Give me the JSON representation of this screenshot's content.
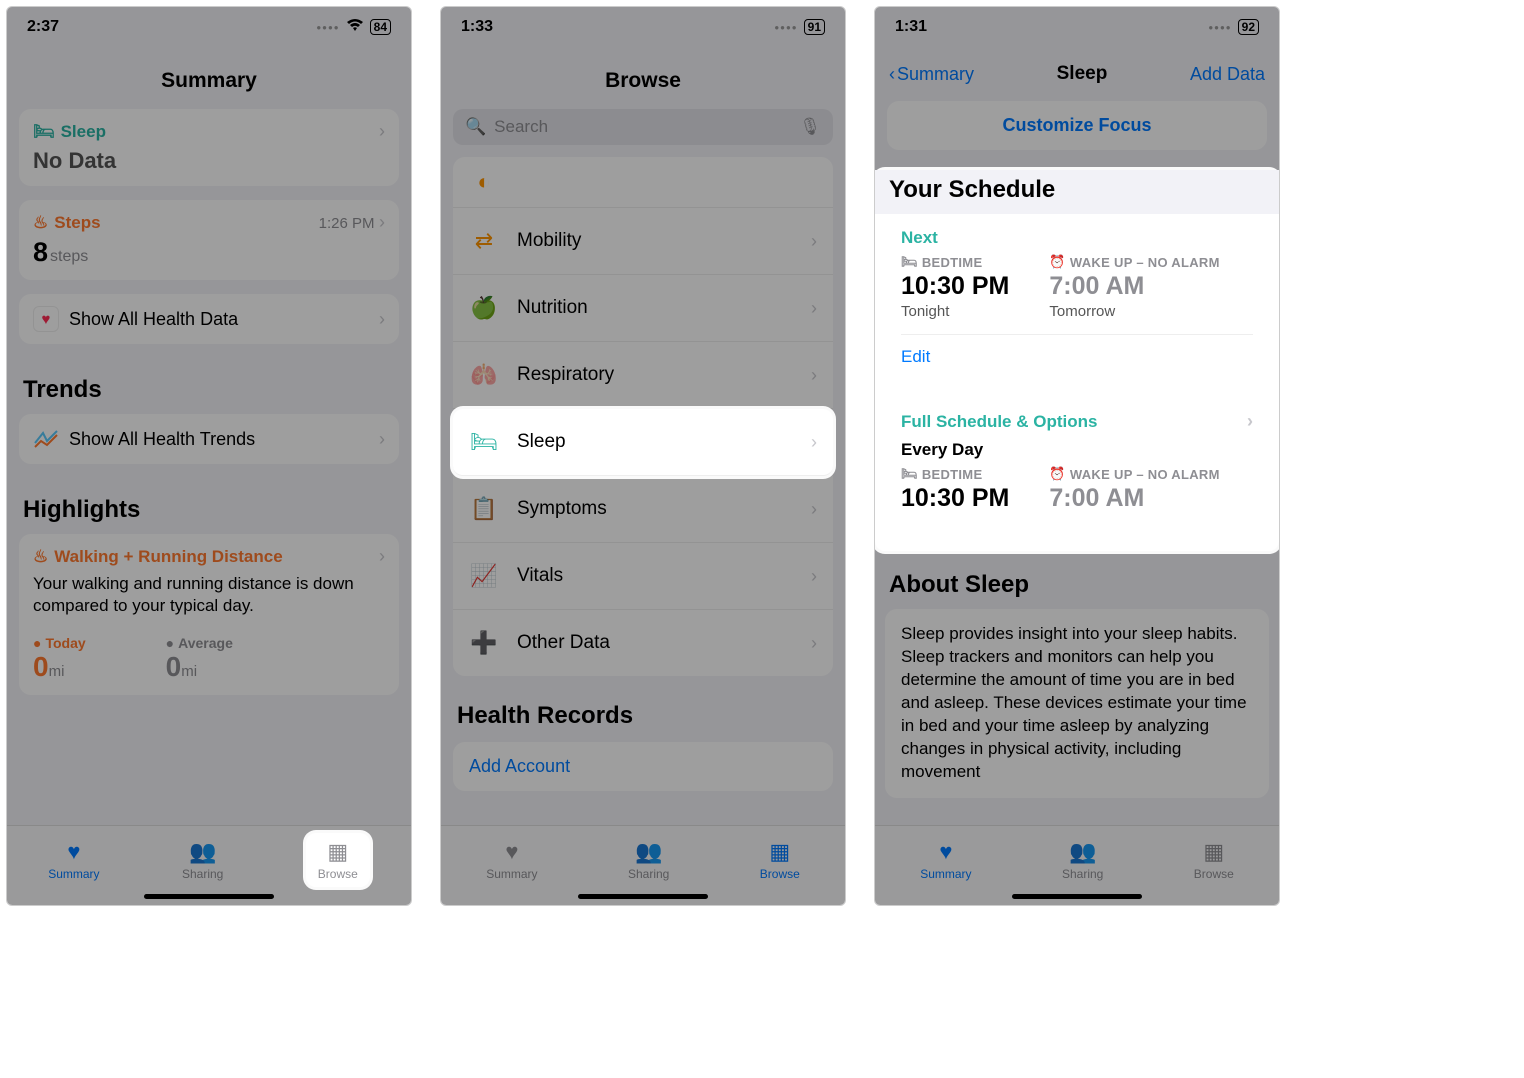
{
  "screen1": {
    "status_time": "2:37",
    "battery": "84",
    "title": "Summary",
    "sleep_label": "Sleep",
    "sleep_nodata": "No Data",
    "steps_label": "Steps",
    "steps_time": "1:26 PM",
    "steps_value": "8",
    "steps_unit": "steps",
    "show_all_health": "Show All Health Data",
    "trends_heading": "Trends",
    "show_all_trends": "Show All Health Trends",
    "highlights_heading": "Highlights",
    "highlight_title": "Walking + Running Distance",
    "highlight_body": "Your walking and running distance is down compared to your typical day.",
    "today_label": "Today",
    "avg_label": "Average",
    "today_val": "0",
    "avg_val": "0",
    "dist_unit": "mi",
    "tabs": {
      "summary": "Summary",
      "sharing": "Sharing",
      "browse": "Browse"
    }
  },
  "screen2": {
    "status_time": "1:33",
    "battery": "91",
    "title": "Browse",
    "search_placeholder": "Search",
    "categories": {
      "mobility": "Mobility",
      "nutrition": "Nutrition",
      "respiratory": "Respiratory",
      "sleep": "Sleep",
      "symptoms": "Symptoms",
      "vitals": "Vitals",
      "other": "Other Data"
    },
    "health_records": "Health Records",
    "add_account": "Add Account",
    "tabs": {
      "summary": "Summary",
      "sharing": "Sharing",
      "browse": "Browse"
    }
  },
  "screen3": {
    "status_time": "1:31",
    "battery": "92",
    "back": "Summary",
    "title": "Sleep",
    "add_data": "Add Data",
    "customize": "Customize Focus",
    "schedule_heading": "Your Schedule",
    "next_label": "Next",
    "bedtime_label": "BEDTIME",
    "wakeup_label": "WAKE UP – NO ALARM",
    "bedtime_time": "10:30 PM",
    "wakeup_time": "7:00 AM",
    "tonight": "Tonight",
    "tomorrow": "Tomorrow",
    "edit": "Edit",
    "full_schedule": "Full Schedule & Options",
    "every_day": "Every Day",
    "bedtime_time2": "10:30 PM",
    "wakeup_time2": "7:00 AM",
    "about_heading": "About Sleep",
    "about_body": "Sleep provides insight into your sleep habits. Sleep trackers and monitors can help you determine the amount of time you are in bed and asleep. These devices estimate your time in bed and your time asleep by analyzing changes in physical activity, including movement",
    "tabs": {
      "summary": "Summary",
      "sharing": "Sharing",
      "browse": "Browse"
    }
  }
}
